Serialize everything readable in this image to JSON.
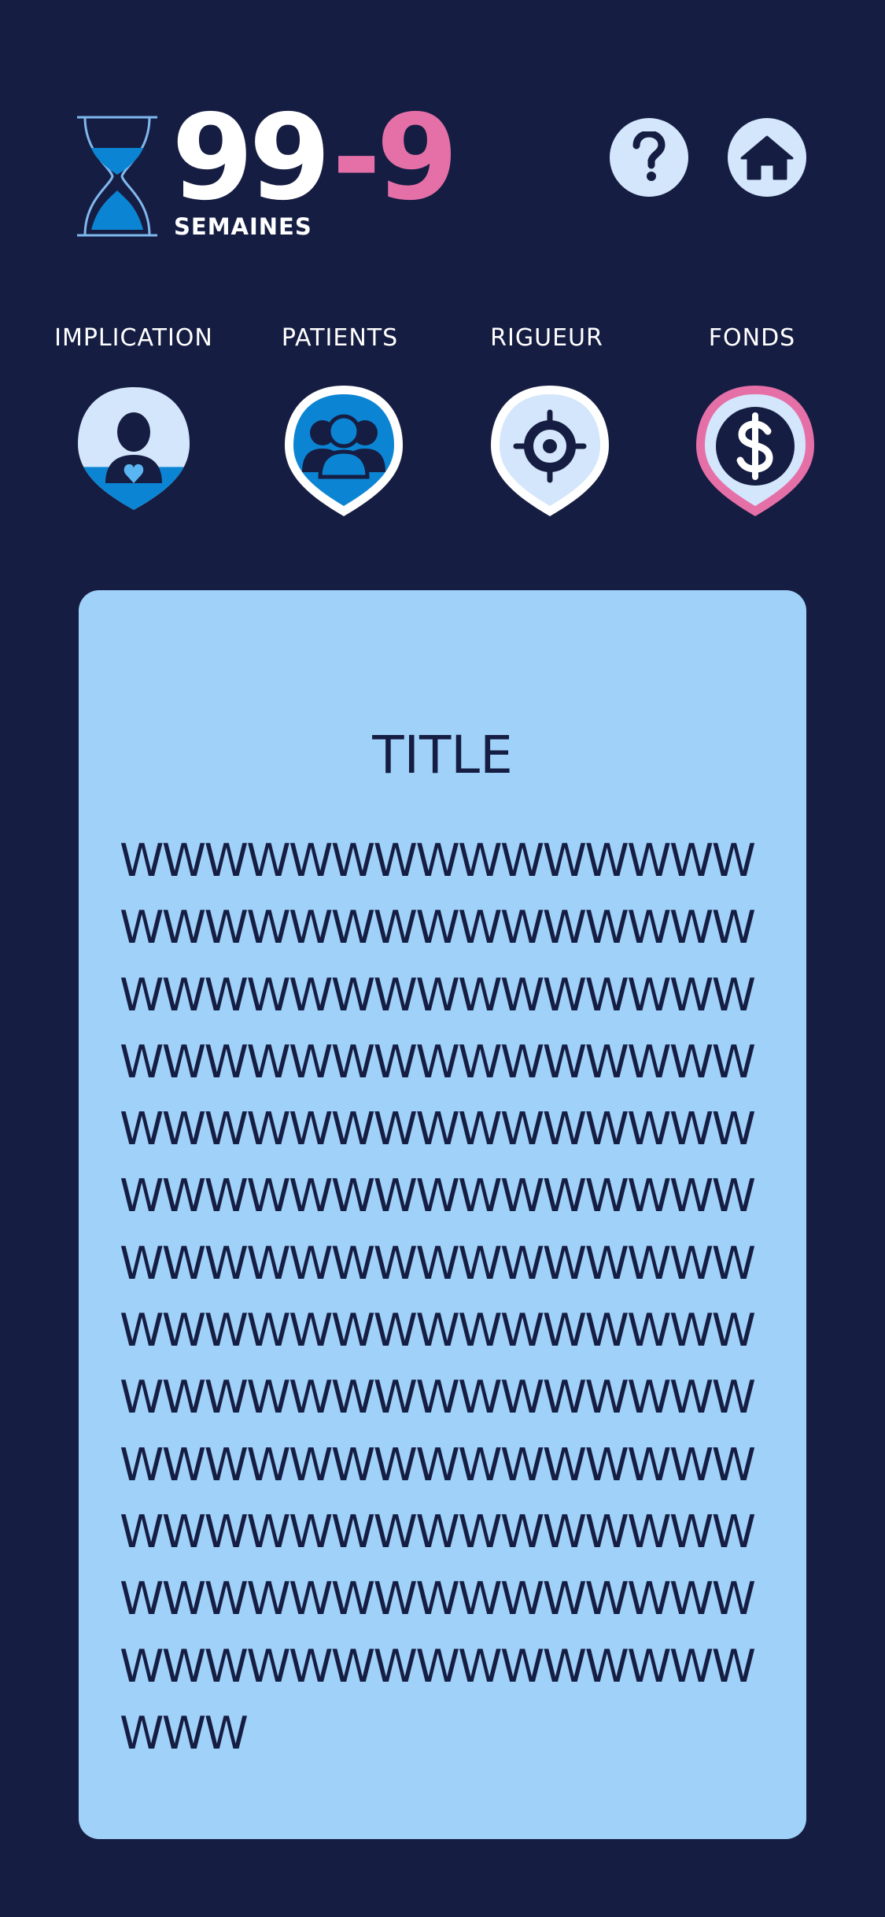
{
  "header": {
    "weeks_remaining": "99",
    "weeks_delta": "-9",
    "weeks_label": "SEMAINES",
    "hourglass_icon": "hourglass-icon",
    "help_icon": "question-mark-icon",
    "home_icon": "home-icon"
  },
  "stats": [
    {
      "label": "IMPLICATION",
      "icon": "person-heart-icon",
      "level": 0.35,
      "status": "normal"
    },
    {
      "label": "PATIENTS",
      "icon": "group-people-icon",
      "level": 1.0,
      "status": "normal"
    },
    {
      "label": "RIGUEUR",
      "icon": "crosshair-target-icon",
      "level": 0.0,
      "status": "normal"
    },
    {
      "label": "FONDS",
      "icon": "dollar-coin-icon",
      "level": 0.0,
      "status": "alert"
    }
  ],
  "card": {
    "title": "TITLE",
    "body": "WWWWWWWWWWWWWWWWWWWWWWWWWWWWWWWWWWWWWWWWWWWWWWWWWWWWWWWWWWWWWWWWWWWWWWWWWWWWWWWWWWWWWWWWWWWWWWWWWWWWWWWWWWWWWWWWWWWWWWWWWWWWWWWWWWWWWWWWWWWWWWWWWWWWWWWWWWWWWWWWWWWWWWWWWWWWWWWWWWWWWWWWWWWWWWWWWWWWWW"
  },
  "colors": {
    "background": "#161d42",
    "accent_blue": "#0b85d3",
    "light_blue": "#d3e6fb",
    "card": "#9fd1f9",
    "alert_pink": "#e570a8",
    "text_dark": "#161d42",
    "text_light": "#ffffff"
  }
}
